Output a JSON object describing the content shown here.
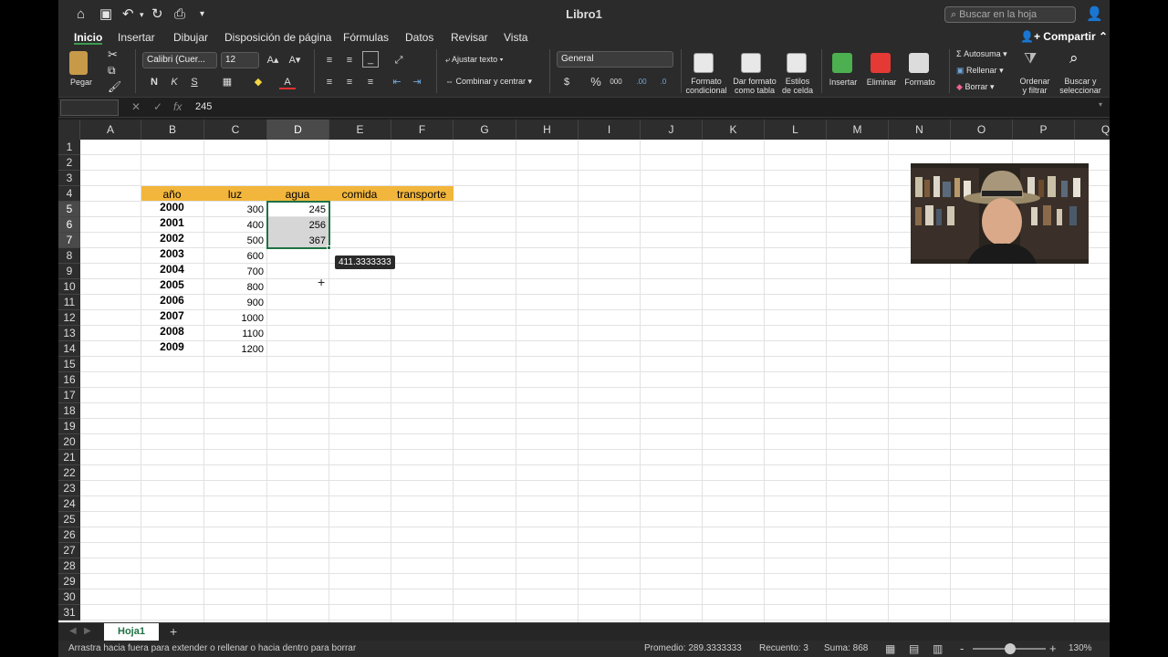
{
  "titlebar": {
    "title": "Libro1",
    "search_placeholder": "Buscar en la hoja",
    "home_icon": "home-icon",
    "save_icon": "save-icon",
    "undo_icon": "undo-icon",
    "redo_icon": "redo-icon",
    "print_icon": "print-icon"
  },
  "tabs": [
    "Inicio",
    "Insertar",
    "Dibujar",
    "Disposición de página",
    "Fórmulas",
    "Datos",
    "Revisar",
    "Vista"
  ],
  "share_label": "Compartir",
  "ribbon": {
    "paste_label": "Pegar",
    "font_name": "Calibri (Cuer...",
    "font_size": "12",
    "bold": "N",
    "italic": "K",
    "underline": "S",
    "wrap_text": "Ajustar texto",
    "merge_center": "Combinar y centrar",
    "number_format": "General",
    "currency": "$",
    "percent": "%",
    "thousands": "000",
    "cond_format": [
      "Formato",
      "condicional"
    ],
    "format_table": [
      "Dar formato",
      "como tabla"
    ],
    "cell_styles": [
      "Estilos",
      "de celda"
    ],
    "insert": "Insertar",
    "delete": "Eliminar",
    "format": "Formato",
    "autosum": "Autosuma",
    "fill": "Rellenar",
    "clear": "Borrar",
    "sort_filter": [
      "Ordenar",
      "y filtrar"
    ],
    "find_select": [
      "Buscar y",
      "seleccionar"
    ]
  },
  "formula_bar": {
    "name_box": "",
    "fx": "fx",
    "value": "245"
  },
  "columns": [
    "A",
    "B",
    "C",
    "D",
    "E",
    "F",
    "G",
    "H",
    "I",
    "J",
    "K",
    "L",
    "M",
    "N",
    "O",
    "P",
    "Q"
  ],
  "rows": [
    "1",
    "2",
    "3",
    "4",
    "5",
    "6",
    "7",
    "8",
    "9",
    "10",
    "11",
    "12",
    "13",
    "14",
    "15",
    "16",
    "17",
    "18",
    "19",
    "20",
    "21",
    "22",
    "23",
    "24",
    "25",
    "26",
    "27",
    "28",
    "29",
    "30",
    "31"
  ],
  "table": {
    "headers": [
      "año",
      "luz",
      "agua",
      "comida",
      "transporte"
    ],
    "years": [
      "2000",
      "2001",
      "2002",
      "2003",
      "2004",
      "2005",
      "2006",
      "2007",
      "2008",
      "2009"
    ],
    "luz": [
      "300",
      "400",
      "500",
      "600",
      "700",
      "800",
      "900",
      "1000",
      "1100",
      "1200"
    ],
    "agua": [
      "245",
      "256",
      "367"
    ]
  },
  "tooltip": "411.3333333",
  "crosshair": "+",
  "sheet_tab": "Hoja1",
  "add_sheet": "+",
  "status": {
    "hint": "Arrastra hacia fuera para extender o rellenar o hacia dentro para borrar",
    "average": "Promedio: 289.3333333",
    "count": "Recuento: 3",
    "sum": "Suma: 868",
    "zoom": "130%",
    "zoom_minus": "-",
    "zoom_plus": "+"
  }
}
